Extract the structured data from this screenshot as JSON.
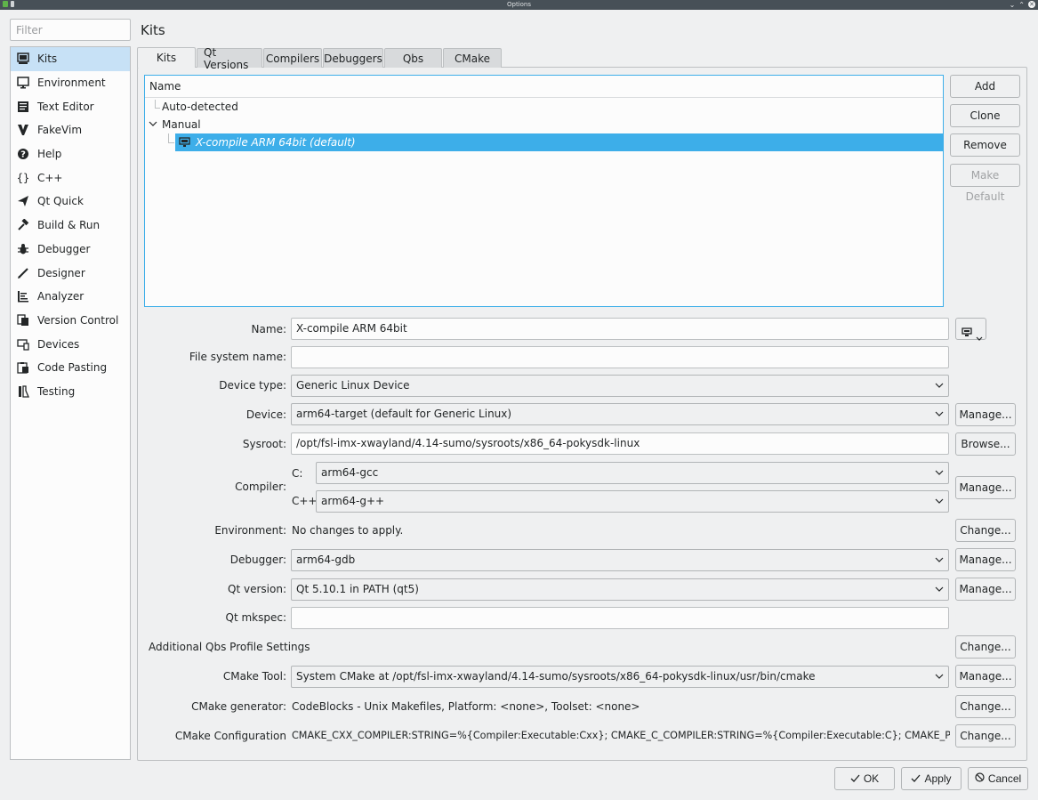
{
  "window": {
    "title": "Options"
  },
  "filter": {
    "placeholder": "Filter"
  },
  "sidebar": {
    "items": [
      {
        "label": "Kits",
        "icon": "kits-icon"
      },
      {
        "label": "Environment",
        "icon": "monitor-icon"
      },
      {
        "label": "Text Editor",
        "icon": "text-editor-icon"
      },
      {
        "label": "FakeVim",
        "icon": "fakevim-icon"
      },
      {
        "label": "Help",
        "icon": "help-icon"
      },
      {
        "label": "C++",
        "icon": "braces-icon"
      },
      {
        "label": "Qt Quick",
        "icon": "qt-quick-icon"
      },
      {
        "label": "Build & Run",
        "icon": "hammer-icon"
      },
      {
        "label": "Debugger",
        "icon": "bug-icon"
      },
      {
        "label": "Designer",
        "icon": "pen-icon"
      },
      {
        "label": "Analyzer",
        "icon": "analyzer-icon"
      },
      {
        "label": "Version Control",
        "icon": "version-control-icon"
      },
      {
        "label": "Devices",
        "icon": "devices-icon"
      },
      {
        "label": "Code Pasting",
        "icon": "code-pasting-icon"
      },
      {
        "label": "Testing",
        "icon": "testing-icon"
      }
    ]
  },
  "page": {
    "title": "Kits"
  },
  "tabs": [
    "Kits",
    "Qt Versions",
    "Compilers",
    "Debuggers",
    "Qbs",
    "CMake"
  ],
  "tree": {
    "header": "Name",
    "auto_detected": "Auto-detected",
    "manual": "Manual",
    "selected_kit": "X-compile ARM 64bit (default)"
  },
  "kit_buttons": {
    "add": "Add",
    "clone": "Clone",
    "remove": "Remove",
    "make_default": "Make Default"
  },
  "form": {
    "name_label": "Name:",
    "name_value": "X-compile ARM 64bit",
    "fs_name_label": "File system name:",
    "fs_name_value": "",
    "device_type_label": "Device type:",
    "device_type_value": "Generic Linux Device",
    "device_label": "Device:",
    "device_value": "arm64-target (default for Generic Linux)",
    "sysroot_label": "Sysroot:",
    "sysroot_value": "/opt/fsl-imx-xwayland/4.14-sumo/sysroots/x86_64-pokysdk-linux",
    "compiler_label": "Compiler:",
    "compiler_c_label": "C:",
    "compiler_c_value": "arm64-gcc",
    "compiler_cxx_label": "C++:",
    "compiler_cxx_value": "arm64-g++",
    "environment_label": "Environment:",
    "environment_value": "No changes to apply.",
    "debugger_label": "Debugger:",
    "debugger_value": "arm64-gdb",
    "qt_version_label": "Qt version:",
    "qt_version_value": "Qt 5.10.1 in PATH (qt5)",
    "qt_mkspec_label": "Qt mkspec:",
    "qt_mkspec_value": "",
    "qbs_label": "Additional Qbs Profile Settings",
    "cmake_tool_label": "CMake Tool:",
    "cmake_tool_value": "System CMake at /opt/fsl-imx-xwayland/4.14-sumo/sysroots/x86_64-pokysdk-linux/usr/bin/cmake",
    "cmake_generator_label": "CMake generator:",
    "cmake_generator_value": "CodeBlocks - Unix Makefiles, Platform: <none>, Toolset: <none>",
    "cmake_config_label": "CMake Configuration",
    "cmake_config_value": "CMAKE_CXX_COMPILER:STRING=%{Compiler:Executable:Cxx}; CMAKE_C_COMPILER:STRING=%{Compiler:Executable:C}; CMAKE_PREFIX_PATH:ST..."
  },
  "side_buttons": {
    "manage": "Manage...",
    "browse": "Browse...",
    "change": "Change..."
  },
  "footer": {
    "ok": "OK",
    "apply": "Apply",
    "cancel": "Cancel"
  }
}
